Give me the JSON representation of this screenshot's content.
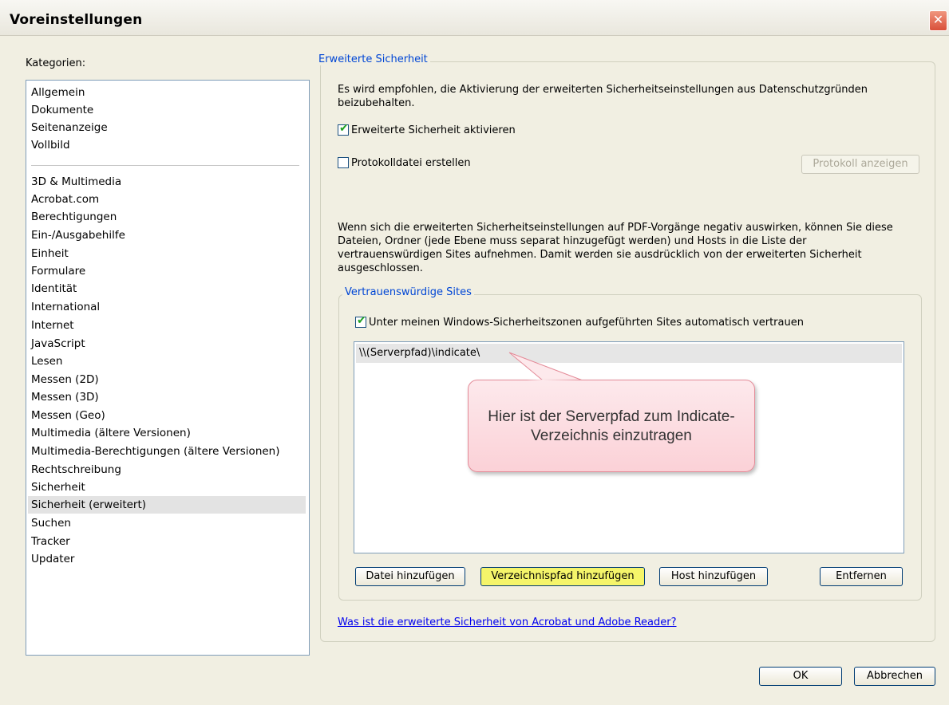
{
  "window": {
    "title": "Voreinstellungen",
    "close_glyph": "✕"
  },
  "categories": {
    "label": "Kategorien:",
    "group1": [
      "Allgemein",
      "Dokumente",
      "Seitenanzeige",
      "Vollbild"
    ],
    "group2": [
      "3D & Multimedia",
      "Acrobat.com",
      "Berechtigungen",
      "Ein-/Ausgabehilfe",
      "Einheit",
      "Formulare",
      "Identität",
      "International",
      "Internet",
      "JavaScript",
      "Lesen",
      "Messen (2D)",
      "Messen (3D)",
      "Messen (Geo)",
      "Multimedia (ältere Versionen)",
      "Multimedia-Berechtigungen (ältere Versionen)",
      "Rechtschreibung",
      "Sicherheit",
      "Sicherheit (erweitert)",
      "Suchen",
      "Tracker",
      "Updater"
    ],
    "selected": "Sicherheit (erweitert)"
  },
  "enhanced": {
    "legend": "Erweiterte Sicherheit",
    "recommendation": "Es wird empfohlen, die Aktivierung der erweiterten Sicherheitseinstellungen aus Datenschutzgründen beizubehalten.",
    "enable_label": "Erweiterte Sicherheit aktivieren",
    "enable_checked": true,
    "log_label": "Protokolldatei erstellen",
    "log_checked": false,
    "view_log_button": "Protokoll anzeigen",
    "info": "Wenn sich die erweiterten Sicherheitseinstellungen auf PDF-Vorgänge negativ auswirken, können Sie diese Dateien, Ordner (jede Ebene muss separat hinzugefügt werden) und Hosts in die Liste der vertrauenswürdigen Sites aufnehmen. Damit werden sie ausdrücklich von der erweiterten Sicherheit ausgeschlossen."
  },
  "trusted": {
    "legend": "Vertrauenswürdige Sites",
    "auto_trust_label": "Unter meinen Windows-Sicherheitszonen aufgeführten Sites automatisch vertrauen",
    "auto_trust_checked": true,
    "entries": [
      "\\\\(Serverpfad)\\indicate\\"
    ],
    "callout": "Hier ist der Serverpfad zum Indicate-Verzeichnis einzutragen",
    "buttons": {
      "add_file": "Datei hinzufügen",
      "add_folder": "Verzeichnispfad hinzufügen",
      "add_host": "Host hinzufügen",
      "remove": "Entfernen"
    }
  },
  "help_link": "Was ist die erweiterte Sicherheit von Acrobat und Adobe Reader?",
  "footer": {
    "ok": "OK",
    "cancel": "Abbrechen"
  }
}
